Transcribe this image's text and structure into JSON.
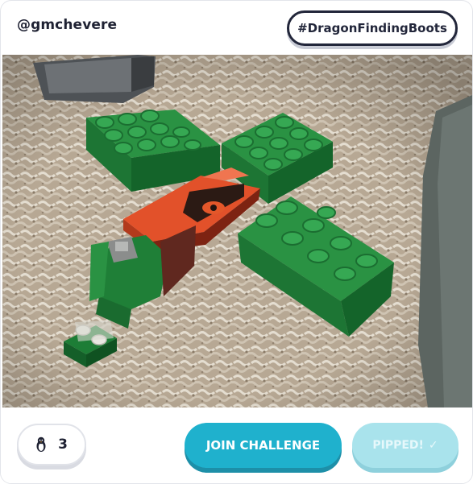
{
  "post": {
    "username": "@gmchevere",
    "hashtag": "#DragonFindingBoots"
  },
  "photo": {
    "alt": "Photo of a green LEGO DUPLO dragon build with an orange wing on carpet"
  },
  "footer": {
    "pips_count": "3",
    "pips_icon": "penguin-icon",
    "join_label": "JOIN CHALLENGE",
    "pipped_label": "PIPPED!",
    "pipped_check": "✓"
  },
  "colors": {
    "accent": "#1fb1cd",
    "accent_disabled": "#a9e3ec",
    "text_dark": "#1f2233"
  }
}
